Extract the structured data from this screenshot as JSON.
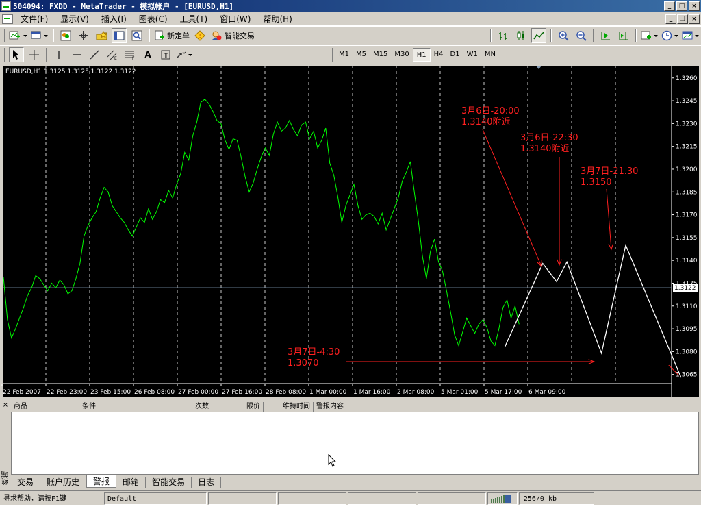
{
  "window": {
    "title": "504094: FXDD - MetaTrader - 模拟帐户 - [EURUSD,H1]"
  },
  "menu": [
    "文件(F)",
    "显示(V)",
    "插入(I)",
    "图表(C)",
    "工具(T)",
    "窗口(W)",
    "帮助(H)"
  ],
  "toolbar": {
    "new_order_label": "新定单",
    "expert_label": "智能交易"
  },
  "timeframes": [
    "M1",
    "M5",
    "M15",
    "M30",
    "H1",
    "H4",
    "D1",
    "W1",
    "MN"
  ],
  "active_timeframe": "H1",
  "chart_header": "EURUSD,H1  1.3125 1.3125 1.3122 1.3122",
  "current_price_label": "1.3122",
  "chart_data": {
    "type": "line",
    "symbol": "EURUSD",
    "timeframe": "H1",
    "y_ticks": [
      "1.3260",
      "1.3245",
      "1.3230",
      "1.3215",
      "1.3200",
      "1.3185",
      "1.3170",
      "1.3155",
      "1.3140",
      "1.3125",
      "1.3110",
      "1.3095",
      "1.3080",
      "1.3065"
    ],
    "ylim": [
      1.3059,
      1.3268
    ],
    "x_ticks": [
      "22 Feb 2007",
      "22 Feb 23:00",
      "23 Feb 15:00",
      "26 Feb 08:00",
      "27 Feb 00:00",
      "27 Feb 16:00",
      "28 Feb 08:00",
      "1 Mar 00:00",
      "1 Mar 16:00",
      "2 Mar 08:00",
      "5 Mar 01:00",
      "5 Mar 17:00",
      "6 Mar 09:00"
    ],
    "bar_count": 185,
    "price_series": {
      "name": "EURUSD",
      "color": "#00ff00",
      "values": [
        1.3129,
        1.3101,
        1.3089,
        1.3095,
        1.3102,
        1.3109,
        1.3117,
        1.3122,
        1.313,
        1.3128,
        1.3124,
        1.312,
        1.3125,
        1.3122,
        1.3127,
        1.3124,
        1.3118,
        1.312,
        1.3128,
        1.3138,
        1.3156,
        1.3163,
        1.3168,
        1.3172,
        1.3181,
        1.3188,
        1.3185,
        1.3176,
        1.3172,
        1.3168,
        1.3165,
        1.316,
        1.3156,
        1.3162,
        1.3168,
        1.3165,
        1.3174,
        1.3167,
        1.3172,
        1.318,
        1.3178,
        1.3186,
        1.3181,
        1.319,
        1.3197,
        1.3211,
        1.3206,
        1.3222,
        1.3231,
        1.3244,
        1.3246,
        1.3243,
        1.3238,
        1.3232,
        1.323,
        1.3219,
        1.3213,
        1.322,
        1.3219,
        1.3208,
        1.3195,
        1.3185,
        1.3191,
        1.32,
        1.3208,
        1.3214,
        1.3209,
        1.3223,
        1.3231,
        1.3225,
        1.3227,
        1.3232,
        1.3226,
        1.3222,
        1.3229,
        1.3231,
        1.322,
        1.3225,
        1.3214,
        1.3219,
        1.3227,
        1.3204,
        1.3196,
        1.3182,
        1.3165,
        1.3176,
        1.3183,
        1.319,
        1.3176,
        1.3167,
        1.317,
        1.3171,
        1.3169,
        1.3164,
        1.3171,
        1.316,
        1.3167,
        1.3174,
        1.3181,
        1.3192,
        1.3198,
        1.3205,
        1.3185,
        1.3166,
        1.3143,
        1.3128,
        1.3146,
        1.3154,
        1.3139,
        1.3133,
        1.312,
        1.3106,
        1.3091,
        1.3084,
        1.3093,
        1.3102,
        1.3097,
        1.3092,
        1.3098,
        1.3101,
        1.3096,
        1.3087,
        1.3084,
        1.3095,
        1.3109,
        1.3114,
        1.3102,
        1.311,
        1.3098
      ]
    },
    "projection_series": {
      "name": "projection",
      "color": "#ffffff",
      "points": [
        {
          "bar": 145,
          "price": 1.3083
        },
        {
          "bar": 156,
          "price": 1.3138
        },
        {
          "bar": 160,
          "price": 1.3126
        },
        {
          "bar": 163,
          "price": 1.3139
        },
        {
          "bar": 173,
          "price": 1.3079
        },
        {
          "bar": 180,
          "price": 1.315
        },
        {
          "bar": 196,
          "price": 1.3063
        }
      ]
    },
    "current_price": 1.3122,
    "annotations": [
      {
        "lines": [
          "3月6日-20:00",
          "1.3140附近"
        ],
        "color": "#ff2020"
      },
      {
        "lines": [
          "3月6日-22:30",
          "1.3140附近"
        ],
        "color": "#ff2020"
      },
      {
        "lines": [
          "3月7日-21.30",
          "1.3150"
        ],
        "color": "#ff2020"
      },
      {
        "lines": [
          "3月7日-4:30",
          "1.3070"
        ],
        "color": "#ff2020"
      }
    ]
  },
  "terminal": {
    "side_label": "终端",
    "columns": [
      "商品",
      "条件",
      "次数",
      "限价",
      "维持时间",
      "警报内容"
    ],
    "tabs": [
      "交易",
      "账户历史",
      "警报",
      "邮箱",
      "智能交易",
      "日志"
    ],
    "active_tab": "警报"
  },
  "statusbar": {
    "help_text": "寻求帮助，请按F1键",
    "profile": "Default",
    "traffic": "256/0 kb"
  }
}
